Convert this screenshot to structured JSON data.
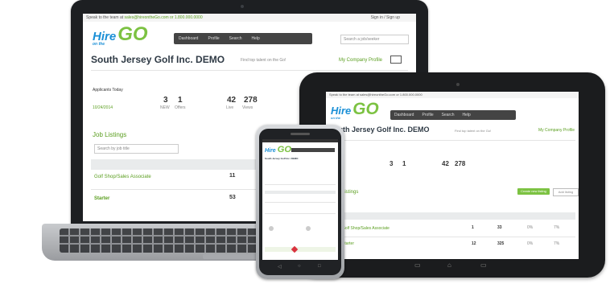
{
  "laptop": {
    "topbar_left": "Speak to the team at ",
    "topbar_link": "sales@hireontheGo.com or 1.800.000.0000",
    "topbar_right": "Sign in / Sign up",
    "logo_main": "Hire",
    "logo_sub": "on the",
    "logo_go": "GO",
    "nav": [
      "Dashboard",
      "Profile",
      "Search",
      "Help"
    ],
    "search_placeholder": "Search a job/seeker",
    "company": "South Jersey Golf Inc. DEMO",
    "tagline": "Find top talent on the Go!",
    "profile_link": "My Company Profile",
    "applicants_label": "Applicants Today",
    "applicants_date": "10/24/2014",
    "stat1_value": "3",
    "stat1_label": "NEW",
    "stat2_value": "1",
    "stat2_label": "Offers",
    "stat3_value": "42",
    "stat3_label": "Live",
    "stat4_value": "278",
    "stat4_label": "Views",
    "section": "Job Listings",
    "search_job": "Search by job title",
    "row1_title": "Golf Shop/Sales Associate",
    "row1_value": "11",
    "row2_title": "Starter",
    "row2_value": "53"
  },
  "tablet": {
    "topbar_left": "Speak to the team at sales@hireontheGo.com or 1.800.000.0000",
    "logo_main": "Hire",
    "logo_sub": "on the",
    "logo_go": "GO",
    "nav": [
      "Dashboard",
      "Profile",
      "Search",
      "Help"
    ],
    "company": "South Jersey Golf Inc. DEMO",
    "tagline": "Find top talent on the Go!",
    "profile_link": "My Company Profile",
    "section": "Listings",
    "button_primary": "Create new listing",
    "button_secondary": "Add listing",
    "stat1_value": "3",
    "stat2_value": "1",
    "stat3_value": "42",
    "stat4_value": "278",
    "row1_title": "Golf Shop/Sales Associate",
    "row1_values": [
      "1",
      "33",
      "0%",
      "7%"
    ],
    "row2_title": "Starter",
    "row2_values": [
      "12",
      "325",
      "0%",
      "7%"
    ]
  },
  "phone": {
    "logo_main": "Hire",
    "logo_go": "GO",
    "company": "South Jersey Golf Inc. DEMO"
  }
}
